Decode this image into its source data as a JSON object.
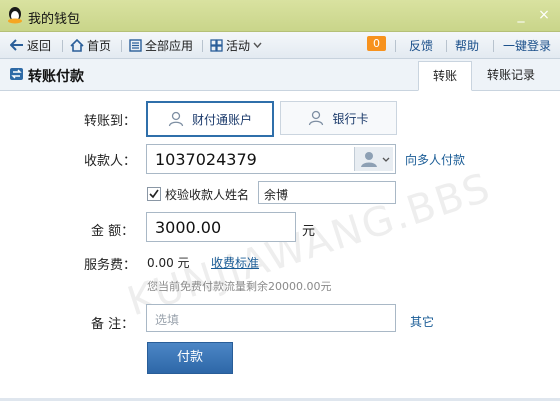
{
  "window": {
    "title": "我的钱包",
    "minimize": "_",
    "close": "×"
  },
  "toolbar": {
    "back": "返回",
    "home": "首页",
    "all_apps": "全部应用",
    "activity": "活动",
    "badge": "0",
    "feedback": "反馈",
    "help": "帮助",
    "login": "一键登录"
  },
  "header": {
    "title": "转账付款",
    "tabs": [
      {
        "label": "转账",
        "active": true
      },
      {
        "label": "转账记录",
        "active": false
      }
    ]
  },
  "form": {
    "transfer_to_label": "转账到：",
    "options": [
      "财付通账户",
      "银行卡"
    ],
    "payee_label": "收款人：",
    "payee_value": "1037024379",
    "multi_pay_link": "向多人付款",
    "verify_label": "校验收款人姓名",
    "verify_checked": true,
    "name_value": "余博",
    "amount_label": "金  额：",
    "amount_value": "3000.00",
    "currency": "元",
    "fee_label": "服务费：",
    "fee_value": "0.00 元",
    "fee_link": "收费标准",
    "free_quota_note": "您当前免费付款流量剩余20000.00元",
    "memo_label": "备  注：",
    "memo_placeholder": "选填",
    "other_link": "其它",
    "pay_button": "付款"
  },
  "watermark": "KUNJIAWANG.BBS"
}
